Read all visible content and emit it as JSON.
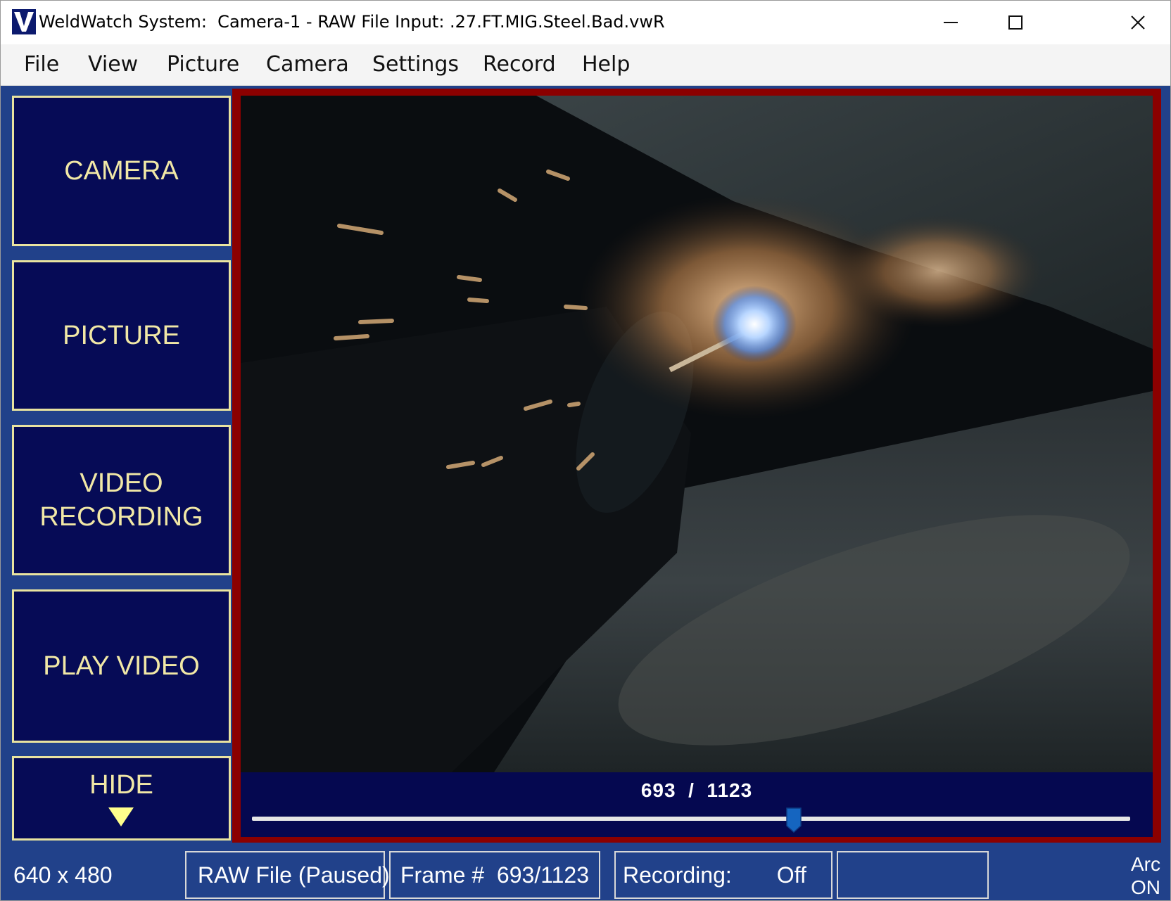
{
  "window": {
    "title": "WeldWatch System:  Camera-1 - RAW File Input: .27.FT.MIG.Steel.Bad.vwR",
    "logo_letter": "V"
  },
  "menu": [
    "File",
    "View",
    "Picture",
    "Camera",
    "Settings",
    "Record",
    "Help"
  ],
  "sidebar": {
    "camera": "CAMERA",
    "picture": "PICTURE",
    "video_recording_line1": "VIDEO",
    "video_recording_line2": "RECORDING",
    "play_video": "PLAY VIDEO",
    "hide": "HIDE"
  },
  "player": {
    "current_frame": 693,
    "total_frames": 1123,
    "counter_text": "693  /  1123"
  },
  "status": {
    "resolution": "640 x 480",
    "source": "RAW File (Paused)",
    "frame": "Frame #  693/1123",
    "recording_label": "Recording:",
    "recording_value": "Off",
    "extra": "",
    "arc_label": "Arc",
    "arc_value": "ON"
  },
  "colors": {
    "panel_bg": "#21418a",
    "button_bg": "#060b56",
    "button_text": "#f1e8a6",
    "video_border": "#8b0000",
    "slider_thumb": "#1565c0"
  },
  "icons": {
    "minimize": "minimize-icon",
    "maximize": "maximize-icon",
    "close": "close-icon",
    "hide_arrow": "triangle-down-icon"
  }
}
